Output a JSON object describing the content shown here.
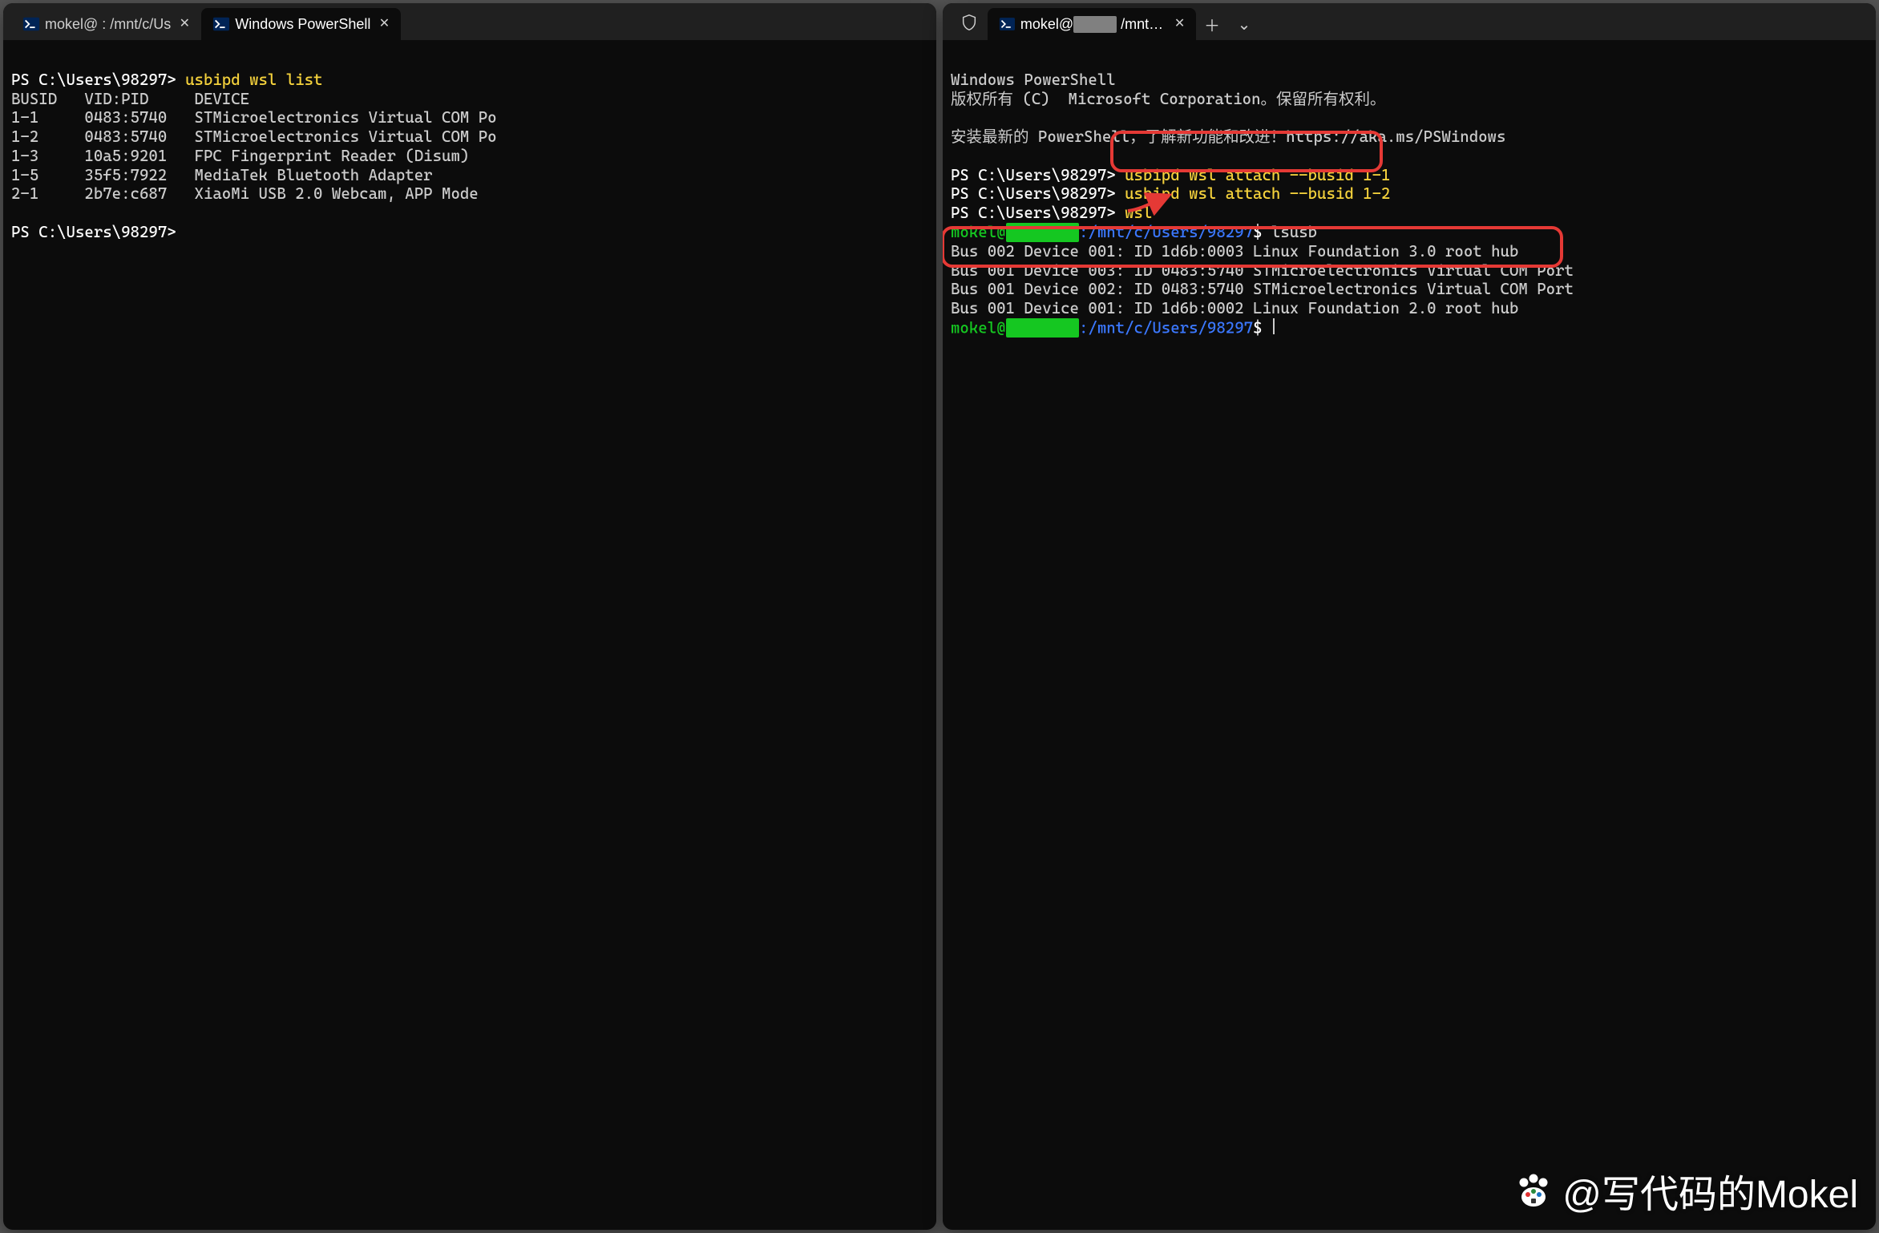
{
  "left": {
    "tabs": [
      {
        "icon": "ps",
        "label": "mokel@        : /mnt/c/Us",
        "active": false
      },
      {
        "icon": "ps",
        "label": "Windows PowerShell",
        "active": true
      }
    ],
    "body": {
      "prompt1": "PS C:\\Users\\98297> ",
      "cmd1": "usbipd wsl list",
      "header": "BUSID   VID:PID     DEVICE",
      "rows": [
        "1-1     0483:5740   STMicroelectronics Virtual COM Po",
        "1-2     0483:5740   STMicroelectronics Virtual COM Po",
        "1-3     10a5:9201   FPC Fingerprint Reader (Disum)",
        "1-5     35f5:7922   MediaTek Bluetooth Adapter",
        "2-1     2b7e:c687   XiaoMi USB 2.0 Webcam, APP Mode"
      ],
      "prompt2": "PS C:\\Users\\98297>"
    }
  },
  "right": {
    "tabs": [
      {
        "icon": "shield",
        "label": "",
        "active": false,
        "narrow": true
      },
      {
        "icon": "ps",
        "label": "mokel@        /mnt/c/U",
        "active": true
      }
    ],
    "body": {
      "head1": "Windows PowerShell",
      "head2": "版权所有 (C)  Microsoft Corporation。保留所有权利。",
      "head3": "安装最新的 PowerShell，了解新功能和改进！https://aka.ms/PSWindows",
      "p1_prompt": "PS C:\\Users\\98297> ",
      "p1_cmd": "usbipd wsl attach --busid 1-1",
      "p2_prompt": "PS C:\\Users\\98297> ",
      "p2_cmd": "usbipd wsl attach --busid 1-2",
      "p3_prompt": "PS C:\\Users\\98297> ",
      "p3_cmd": "wsl",
      "wsl_user": "mokel@",
      "wsl_host_censored": "        ",
      "wsl_path": ":/mnt/c/Users/98297",
      "wsl_dollar": "$ ",
      "wsl_cmd": "lsusb",
      "lsusb": [
        "Bus 002 Device 001: ID 1d6b:0003 Linux Foundation 3.0 root hub",
        "Bus 001 Device 003: ID 0483:5740 STMicroelectronics Virtual COM Port",
        "Bus 001 Device 002: ID 0483:5740 STMicroelectronics Virtual COM Port",
        "Bus 001 Device 001: ID 1d6b:0002 Linux Foundation 2.0 root hub"
      ]
    }
  },
  "watermark": "@写代码的Mokel"
}
